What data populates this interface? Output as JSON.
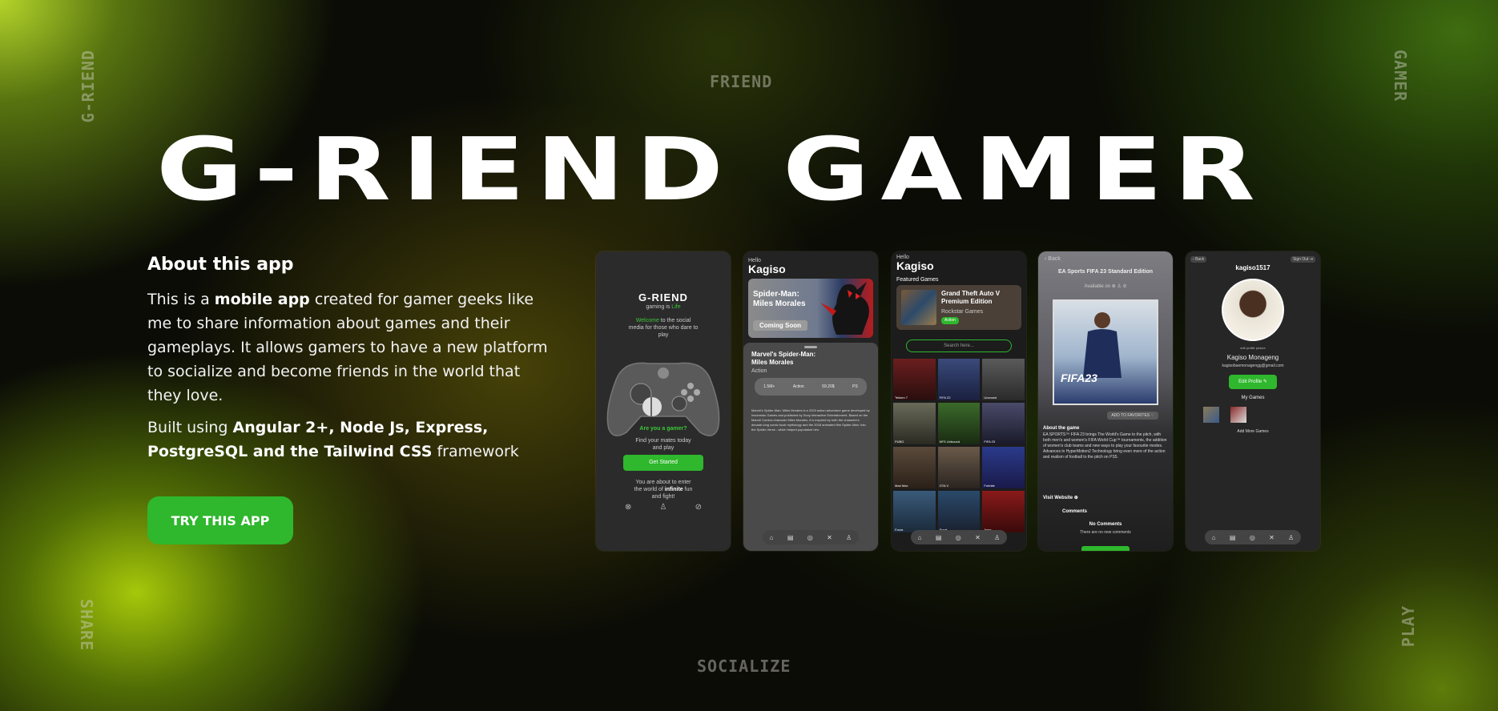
{
  "corners": {
    "top_left": "G-RIEND",
    "top_center": "FRIEND",
    "top_right": "GAMER",
    "bottom_left": "SHARE",
    "bottom_center": "SOCIALIZE",
    "bottom_right": "PLAY"
  },
  "hero": {
    "word1": "G-RIEND",
    "word2": "GAMER"
  },
  "about": {
    "heading": "About this app",
    "p1_a": "This is a ",
    "p1_b": "mobile app",
    "p1_c": " created for gamer geeks like me to share information about games and their gameplays. It allows gamers to have a new platform to socialize and become friends in the world that they love.",
    "p2_a": "Built using ",
    "p2_b": "Angular 2+, Node Js, Express, PostgreSQL and the Tailwind CSS",
    "p2_c": " framework"
  },
  "cta": {
    "label": "TRY THIS APP"
  },
  "phones": {
    "splash": {
      "logo": "G-RIEND",
      "tagline_a": "gaming is ",
      "tagline_b": "Life",
      "welcome_a": "Welcome",
      "welcome_b": " to the social media for those who dare to play",
      "question": "Are you a gamer?",
      "find": "Find your mates today and play",
      "button": "Get Started",
      "about_a": "You are about to enter the world of ",
      "about_b": "infinite",
      "about_c": " fun and fight!"
    },
    "game_detail": {
      "hello": "Hello",
      "name": "Kagiso",
      "banner_title": "Spider-Man: Miles Morales",
      "banner_tag": "Coming Soon",
      "title": "Marvel's Spider-Man: Miles Morales",
      "genre": "Action",
      "stats": [
        "1.5M+",
        "Action",
        "59.20$",
        "PS"
      ],
      "desc": "Marvel's Spider-Man: Miles Morales is a 2020 action-adventure game developed by Insomniac Games and published by Sony Interactive Entertainment. Based on the Marvel Comics character Miles Morales, it is inspired by both the character's decade-long comic book mythology and the 2018 animated film Spider-Man: Into the Spider-Verse - which helped popularize him."
    },
    "featured": {
      "hello": "Hello",
      "name": "Kagiso",
      "section": "Featured Games",
      "featured_title": "Grand Theft Auto V Premium Edition",
      "featured_studio": "Rockstar Games",
      "featured_tag": "Action",
      "search_placeholder": "Search here...",
      "games": [
        "Tekken 7",
        "FIFA 22",
        "Uncrowd",
        "PUBG",
        "NFS Unbound",
        "FIFA 23",
        "Mad Max",
        "GTA V",
        "Fortnite",
        "Forza",
        "Sport",
        "Apex"
      ]
    },
    "fifa": {
      "back": "Back",
      "title": "EA Sports FIFA 23 Standard Edition",
      "available": "Available on",
      "cover_text": "FIFA23",
      "add_fav": "ADD TO FAVORITES",
      "about_heading": "About the game",
      "about_text": "EA SPORTS™ FIFA 23 brings The World's Game to the pitch, with both men's and women's FIFA World Cup™ tournaments, the addition of women's club teams and new ways to play your favourite modes. Advances in HyperMotion2 Technology bring even more of the action and realism of football to the pitch on PS5.",
      "visit": "Visit Website",
      "comments": "Comments",
      "no_comments": "No Comments",
      "no_comments_sub": "There are no new comments"
    },
    "profile": {
      "back": "Back",
      "signout": "Sign Out",
      "username": "kagiso1517",
      "edit_pic": "edit profile picture",
      "full_name": "Kagiso Monageng",
      "email": "kagisobaemonagengg@gmail.com",
      "edit_button": "Edit Profile",
      "my_games": "My Games",
      "add_more": "Add More Games"
    }
  },
  "colors": {
    "accent": "#2fb72d",
    "phone_bg": "#2e2e2e"
  }
}
